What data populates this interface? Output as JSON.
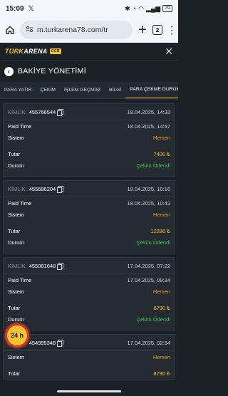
{
  "status": {
    "time": "15:09",
    "app_icon": "x-icon",
    "battery": "70"
  },
  "browser": {
    "url": "m.turkarena78.com/tr",
    "tab_count": "2"
  },
  "site": {
    "logo_main": "TÜRK",
    "logo_second": "ARENA",
    "logo_badge": "GCB"
  },
  "page": {
    "title": "BAKİYE YÖNETİMİ"
  },
  "tabs": [
    "PARA YATIR",
    "ÇEKİM",
    "İŞLEM GEÇMİŞİ",
    "BİLGİ",
    "PARA ÇEKME DURUMU"
  ],
  "labels": {
    "kimlik": "KİMLİK:",
    "paid_time": "Paid Time",
    "sistem": "Sistem",
    "tutar": "Tutar",
    "durum": "Durum"
  },
  "cards": [
    {
      "id": "455766544",
      "date": "18.04.2025, 14:33",
      "paid_time": "18.04.2025, 14:57",
      "sistem": "Hemen",
      "tutar": "7400 ₺",
      "durum": "Çekim Ödendi"
    },
    {
      "id": "455686204",
      "date": "18.04.2025, 10:16",
      "paid_time": "18.04.2025, 10:42",
      "sistem": "Hemen",
      "tutar": "12280 ₺",
      "durum": "Çekim Ödendi"
    },
    {
      "id": "455081648",
      "date": "17.04.2025, 07:22",
      "paid_time": "17.04.2025, 09:34",
      "sistem": "Hemen",
      "tutar": "8790 ₺",
      "durum": "Çekim Ödendi"
    },
    {
      "id": "454995348",
      "date": "17.04.2025, 02:54",
      "paid_time": "",
      "sistem": "Hemen",
      "tutar": "8790 ₺",
      "durum": ""
    }
  ],
  "badge": {
    "label": "24 h"
  },
  "colors": {
    "accent": "#f1c232",
    "paid": "#37c55a",
    "system": "#f0a01c",
    "background": "#1c2126"
  }
}
